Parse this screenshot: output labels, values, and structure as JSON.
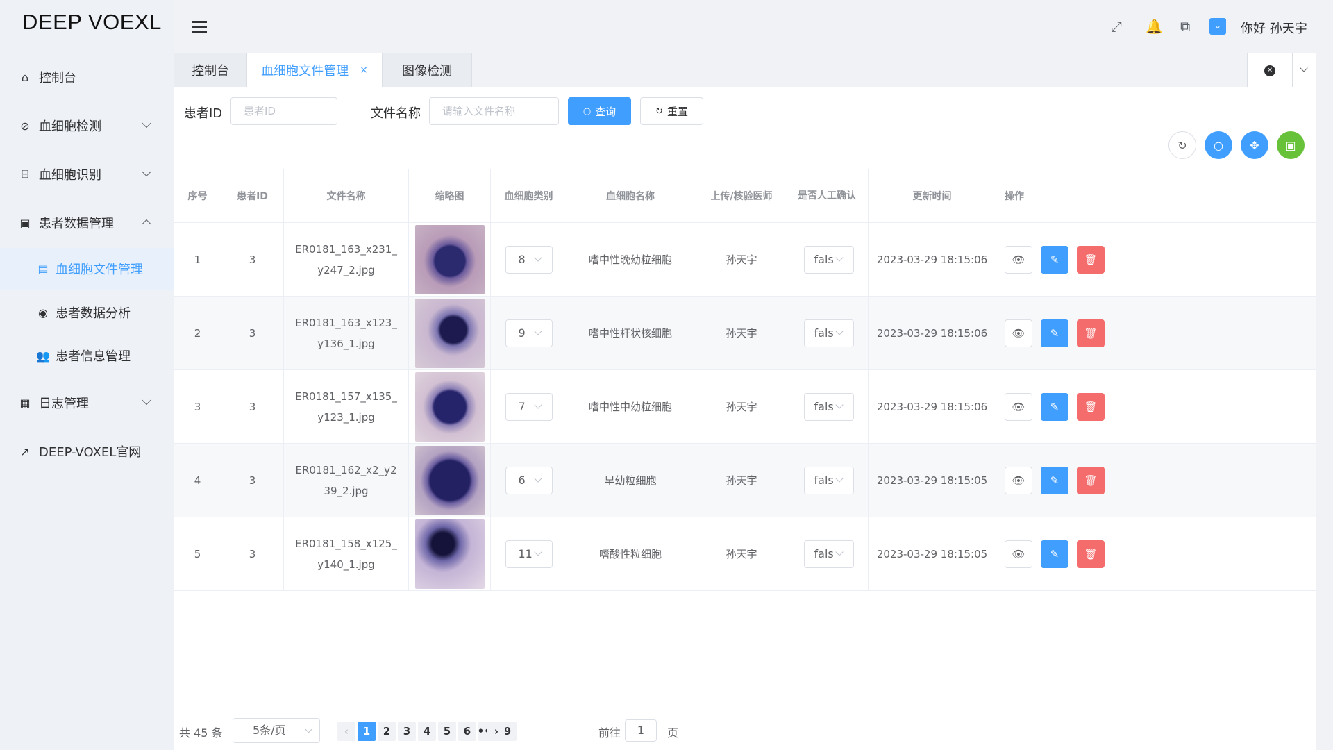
{
  "app": {
    "logo": "DEEP VOEXL"
  },
  "sidebar": {
    "items": [
      {
        "label": "控制台",
        "icon": "home-icon"
      },
      {
        "label": "血细胞检测",
        "icon": "compass-icon"
      },
      {
        "label": "血细胞识别",
        "icon": "bank-icon"
      },
      {
        "label": "患者数据管理",
        "icon": "user-card-icon"
      },
      {
        "label": "日志管理",
        "icon": "book-icon"
      },
      {
        "label": "DEEP-VOXEL官网",
        "icon": "external-link-icon"
      }
    ],
    "subitems": [
      {
        "label": "血细胞文件管理",
        "icon": "document-icon"
      },
      {
        "label": "患者数据分析",
        "icon": "target-icon"
      },
      {
        "label": "患者信息管理",
        "icon": "users-icon"
      }
    ]
  },
  "header": {
    "greeting": "你好 孙天宇"
  },
  "tabs": [
    {
      "label": "控制台"
    },
    {
      "label": "血细胞文件管理",
      "close": "×"
    },
    {
      "label": "图像检测"
    }
  ],
  "search": {
    "patient_label": "患者ID",
    "patient_placeholder": "患者ID",
    "file_label": "文件名称",
    "file_placeholder": "请输入文件名称",
    "query_btn": "查询",
    "reset_btn": "重置"
  },
  "table": {
    "headers": [
      "序号",
      "患者ID",
      "文件名称",
      "缩略图",
      "血细胞类别",
      "血细胞名称",
      "上传/核验医师",
      "是否人工确认",
      "更新时间",
      "操作"
    ],
    "rows": [
      {
        "idx": "1",
        "pid": "3",
        "file": "ER0181_163_x231_y247_2.jpg",
        "cat": "8",
        "name": "嗜中性晚幼粒细胞",
        "doctor": "孙天宇",
        "confirm": "false",
        "time": "2023-03-29 18:15:06"
      },
      {
        "idx": "2",
        "pid": "3",
        "file": "ER0181_163_x123_y136_1.jpg",
        "cat": "9",
        "name": "嗜中性杆状核细胞",
        "doctor": "孙天宇",
        "confirm": "false",
        "time": "2023-03-29 18:15:06"
      },
      {
        "idx": "3",
        "pid": "3",
        "file": "ER0181_157_x135_y123_1.jpg",
        "cat": "7",
        "name": "嗜中性中幼粒细胞",
        "doctor": "孙天宇",
        "confirm": "false",
        "time": "2023-03-29 18:15:06"
      },
      {
        "idx": "4",
        "pid": "3",
        "file": "ER0181_162_x2_y239_2.jpg",
        "cat": "6",
        "name": "早幼粒细胞",
        "doctor": "孙天宇",
        "confirm": "false",
        "time": "2023-03-29 18:15:05"
      },
      {
        "idx": "5",
        "pid": "3",
        "file": "ER0181_158_x125_y140_1.jpg",
        "cat": "11",
        "name": "嗜酸性粒细胞",
        "doctor": "孙天宇",
        "confirm": "false",
        "time": "2023-03-29 18:15:05"
      }
    ]
  },
  "pagination": {
    "total": "共 45 条",
    "page_size": "5条/页",
    "pages": [
      "1",
      "2",
      "3",
      "4",
      "5",
      "6",
      "•••",
      "9"
    ],
    "current": "1",
    "goto_prefix": "前往",
    "goto_value": "1",
    "goto_suffix": "页"
  },
  "colors": {
    "primary": "#409eff",
    "danger": "#f56c6c",
    "success": "#67c23a"
  }
}
